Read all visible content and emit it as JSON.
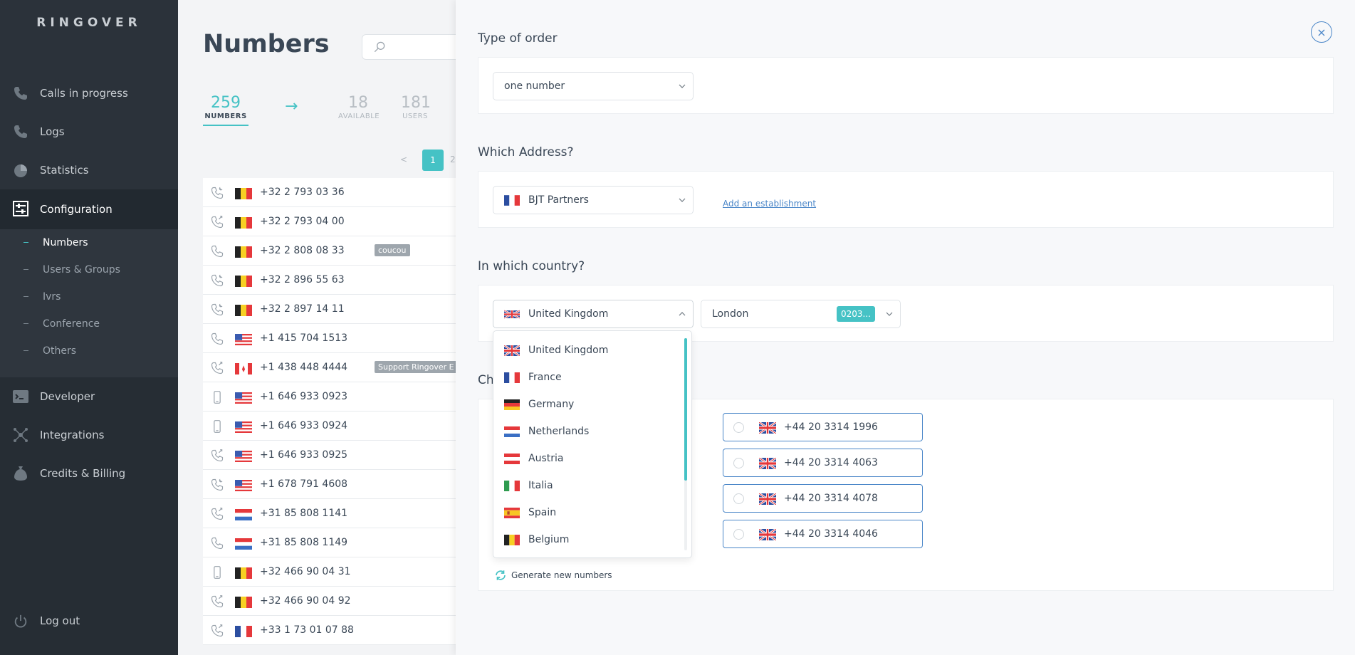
{
  "sidebar": {
    "logo": "RINGOVER",
    "nav": [
      {
        "label": "Calls in progress",
        "icon": "phone-icon"
      },
      {
        "label": "Logs",
        "icon": "call-log-icon"
      },
      {
        "label": "Statistics",
        "icon": "pie-chart-icon"
      },
      {
        "label": "Configuration",
        "icon": "sliders-icon",
        "active": true
      }
    ],
    "submenu": [
      {
        "label": "Numbers",
        "active": true
      },
      {
        "label": "Users & Groups"
      },
      {
        "label": "Ivrs"
      },
      {
        "label": "Conference"
      },
      {
        "label": "Others"
      }
    ],
    "nav_lower": [
      {
        "label": "Developer",
        "icon": "terminal-icon"
      },
      {
        "label": "Integrations",
        "icon": "network-icon"
      },
      {
        "label": "Credits & Billing",
        "icon": "money-bag-icon"
      }
    ],
    "logout": "Log out"
  },
  "main": {
    "title": "Numbers",
    "search_placeholder": "",
    "stats": [
      {
        "value": "259",
        "label": "NUMBERS",
        "active": true
      },
      {
        "value": "18",
        "label": "AVAILABLE"
      },
      {
        "value": "181",
        "label": "USERS"
      }
    ],
    "arrow": "→",
    "pager": {
      "prev": "<",
      "current": "1",
      "next_partial": "2"
    },
    "numbers": [
      {
        "type": "moon-phone-icon",
        "flag": "be",
        "number": "+32 2 793 03 36"
      },
      {
        "type": "forward-phone-icon",
        "flag": "be",
        "number": "+32 2 793 04 00"
      },
      {
        "type": "phone-icon",
        "flag": "be",
        "number": "+32 2 808 08 33",
        "tag": "coucou"
      },
      {
        "type": "moon-phone-icon",
        "flag": "be",
        "number": "+32 2 896 55 63"
      },
      {
        "type": "moon-phone-icon",
        "flag": "be",
        "number": "+32 2 897 14 11"
      },
      {
        "type": "phone-icon",
        "flag": "us",
        "number": "+1 415 704 1513"
      },
      {
        "type": "forward-phone-icon",
        "flag": "ca",
        "number": "+1 438 448 4444",
        "tag": "Support Ringover E"
      },
      {
        "type": "mobile-icon",
        "flag": "us",
        "number": "+1 646 933 0923"
      },
      {
        "type": "mobile-icon",
        "flag": "us",
        "number": "+1 646 933 0924"
      },
      {
        "type": "forward-phone-icon",
        "flag": "us",
        "number": "+1 646 933 0925"
      },
      {
        "type": "moon-phone-icon",
        "flag": "us",
        "number": "+1 678 791 4608"
      },
      {
        "type": "forward-phone-icon",
        "flag": "nl",
        "number": "+31 85 808 1141"
      },
      {
        "type": "phone-icon",
        "flag": "nl",
        "number": "+31 85 808 1149"
      },
      {
        "type": "mobile-icon",
        "flag": "be",
        "number": "+32 466 90 04 31"
      },
      {
        "type": "forward-phone-icon",
        "flag": "be",
        "number": "+32 466 90 04 92"
      },
      {
        "type": "forward-phone-icon",
        "flag": "fr",
        "number": "+33 1 73 01 07 88"
      }
    ]
  },
  "panel": {
    "close_glyph": "×",
    "type_of_order": {
      "title": "Type of order",
      "value": "one number"
    },
    "address": {
      "title": "Which Address?",
      "value": "BJT Partners",
      "flag": "fr",
      "add_link": "Add an establishment"
    },
    "country": {
      "title": "In which country?",
      "value": "United Kingdom",
      "flag": "gb",
      "city": "London",
      "city_badge": "0203...",
      "options": [
        {
          "label": "United Kingdom",
          "flag": "gb"
        },
        {
          "label": "France",
          "flag": "fr"
        },
        {
          "label": "Germany",
          "flag": "de"
        },
        {
          "label": "Netherlands",
          "flag": "nl"
        },
        {
          "label": "Austria",
          "flag": "at"
        },
        {
          "label": "Italia",
          "flag": "it"
        },
        {
          "label": "Spain",
          "flag": "es"
        },
        {
          "label": "Belgium",
          "flag": "be"
        }
      ]
    },
    "choose": {
      "title_partial": "Ch",
      "numbers": [
        "+44 20 3314 1996",
        "+44 20 3314 4063",
        "+44 20 3314 4078",
        "+44 20 3314 4046"
      ],
      "generate": "Generate new numbers"
    },
    "colors": {
      "accent": "#45c2c5",
      "link": "#4a86c8",
      "sidebar": "#2b323a"
    }
  }
}
